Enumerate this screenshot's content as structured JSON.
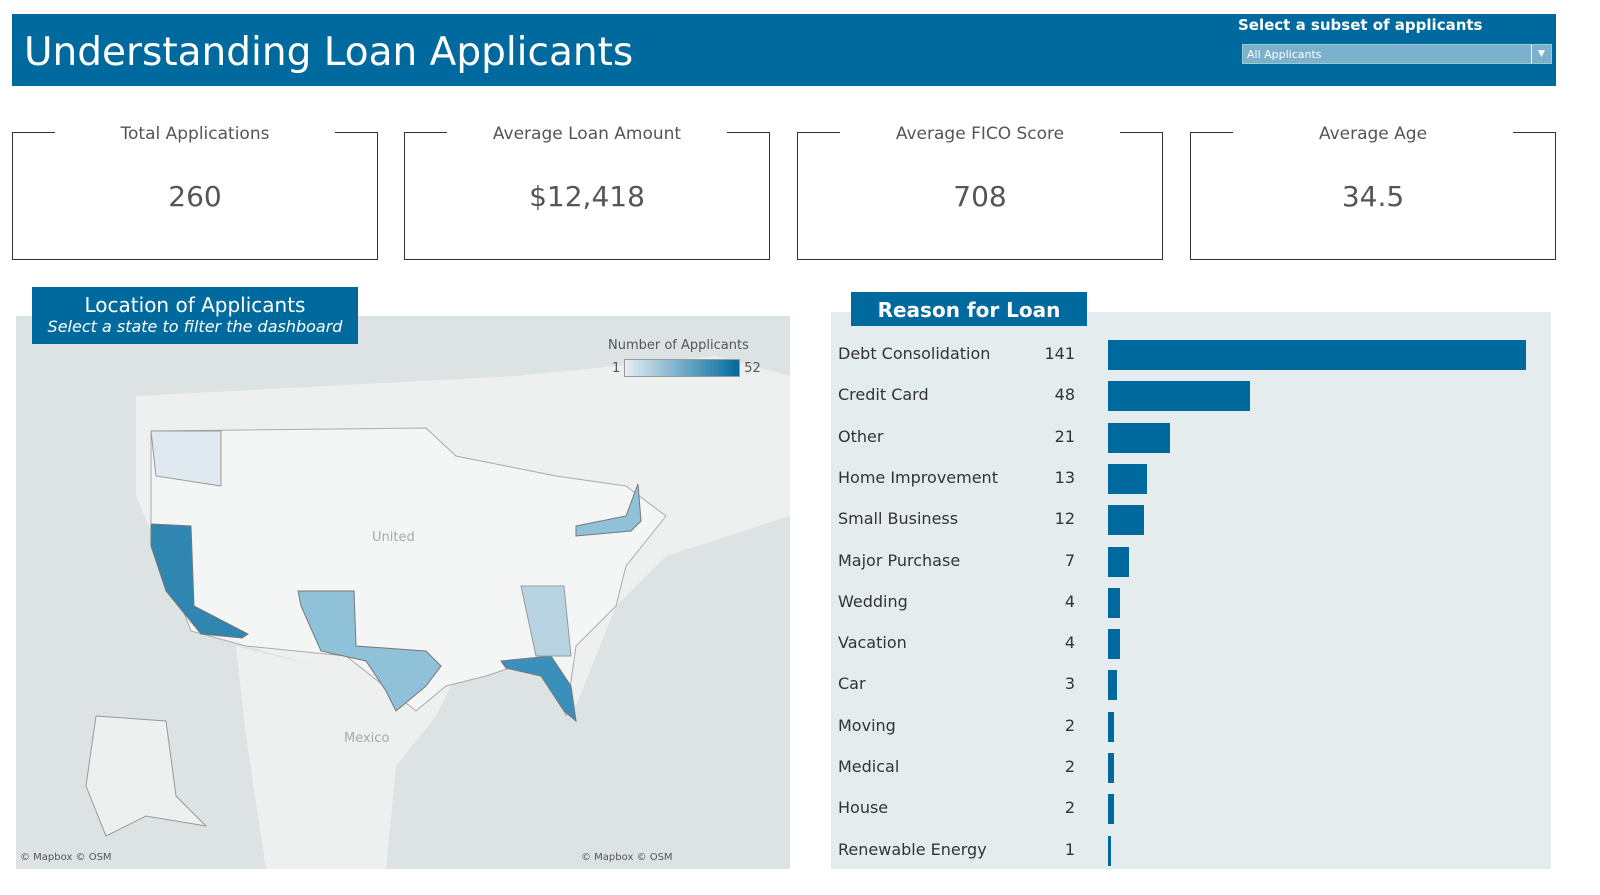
{
  "header": {
    "title": "Understanding Loan Applicants",
    "filter_label": "Select a subset of applicants",
    "filter_value": "All Applicants"
  },
  "kpis": [
    {
      "label": "Total Applications",
      "value": "260"
    },
    {
      "label": "Average Loan Amount",
      "value": "$12,418"
    },
    {
      "label": "Average FICO Score",
      "value": "708"
    },
    {
      "label": "Average Age",
      "value": "34.5"
    }
  ],
  "map": {
    "title": "Location of Applicants",
    "subtitle": "Select a state to filter the dashboard",
    "legend_title": "Number of Applicants",
    "legend_min": "1",
    "legend_max": "52",
    "labels": {
      "us": "United",
      "mexico": "Mexico"
    },
    "credit": "© Mapbox © OSM",
    "colors": {
      "low": "#e6eef3",
      "high": "#006a9e"
    }
  },
  "reasons": {
    "title": "Reason for Loan",
    "items": [
      {
        "label": "Debt Consolidation",
        "value": 141
      },
      {
        "label": "Credit Card",
        "value": 48
      },
      {
        "label": "Other",
        "value": 21
      },
      {
        "label": "Home Improvement",
        "value": 13
      },
      {
        "label": "Small Business",
        "value": 12
      },
      {
        "label": "Major Purchase",
        "value": 7
      },
      {
        "label": "Wedding",
        "value": 4
      },
      {
        "label": "Vacation",
        "value": 4
      },
      {
        "label": "Car",
        "value": 3
      },
      {
        "label": "Moving",
        "value": 2
      },
      {
        "label": "Medical",
        "value": 2
      },
      {
        "label": "House",
        "value": 2
      },
      {
        "label": "Renewable Energy",
        "value": 1
      }
    ]
  }
}
